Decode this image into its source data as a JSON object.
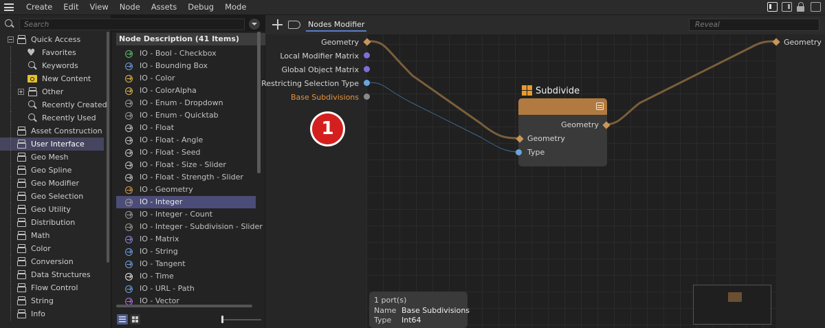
{
  "menubar": {
    "items": [
      "Create",
      "Edit",
      "View",
      "Node",
      "Assets",
      "Debug",
      "Mode"
    ]
  },
  "search": {
    "placeholder": "Search"
  },
  "tree": {
    "items": [
      {
        "label": "Quick Access",
        "icon": "database-icon"
      },
      {
        "label": "Favorites",
        "icon": "heart-icon"
      },
      {
        "label": "Keywords",
        "icon": "magnifier-icon"
      },
      {
        "label": "New Content",
        "icon": "folder-icon"
      },
      {
        "label": "Other",
        "icon": "database-icon"
      },
      {
        "label": "Recently Created",
        "icon": "magnifier-icon"
      },
      {
        "label": "Recently Used",
        "icon": "magnifier-icon"
      },
      {
        "label": "Asset Construction",
        "icon": "database-icon"
      },
      {
        "label": "User Interface",
        "icon": "database-icon"
      },
      {
        "label": "Geo Mesh",
        "icon": "database-icon"
      },
      {
        "label": "Geo Spline",
        "icon": "database-icon"
      },
      {
        "label": "Geo Modifier",
        "icon": "database-icon"
      },
      {
        "label": "Geo Selection",
        "icon": "database-icon"
      },
      {
        "label": "Geo Utility",
        "icon": "database-icon"
      },
      {
        "label": "Distribution",
        "icon": "database-icon"
      },
      {
        "label": "Math",
        "icon": "database-icon"
      },
      {
        "label": "Color",
        "icon": "database-icon"
      },
      {
        "label": "Conversion",
        "icon": "database-icon"
      },
      {
        "label": "Data Structures",
        "icon": "database-icon"
      },
      {
        "label": "Flow Control",
        "icon": "database-icon"
      },
      {
        "label": "String",
        "icon": "database-icon"
      },
      {
        "label": "Info",
        "icon": "database-icon"
      }
    ],
    "selected": "User Interface"
  },
  "node_description": {
    "header": "Node Description (41 Items)",
    "items": [
      {
        "label": "IO - Bool - Checkbox",
        "color": "#5fbf6a"
      },
      {
        "label": "IO - Bounding Box",
        "color": "#6fa0e0"
      },
      {
        "label": "IO - Color",
        "color": "#e0b84a"
      },
      {
        "label": "IO - ColorAlpha",
        "color": "#e0b84a"
      },
      {
        "label": "IO - Enum - Dropdown",
        "color": "#9a9a9a"
      },
      {
        "label": "IO - Enum - Quicktab",
        "color": "#9a9a9a"
      },
      {
        "label": "IO - Float",
        "color": "#c8c8c8"
      },
      {
        "label": "IO - Float - Angle",
        "color": "#c8c8c8"
      },
      {
        "label": "IO - Float - Seed",
        "color": "#c8c8c8"
      },
      {
        "label": "IO - Float - Size - Slider",
        "color": "#c8c8c8"
      },
      {
        "label": "IO - Float - Strength - Slider",
        "color": "#c8c8c8"
      },
      {
        "label": "IO - Geometry",
        "color": "#d69a4a"
      },
      {
        "label": "IO - Integer",
        "color": "#9a9a9a"
      },
      {
        "label": "IO - Integer - Count",
        "color": "#9a9a9a"
      },
      {
        "label": "IO - Integer - Subdivision - Slider",
        "color": "#9a9a9a"
      },
      {
        "label": "IO - Matrix",
        "color": "#8a86e0"
      },
      {
        "label": "IO - String",
        "color": "#6fa0e0"
      },
      {
        "label": "IO - Tangent",
        "color": "#6fa0e0"
      },
      {
        "label": "IO - Time",
        "color": "#e8e8e8"
      },
      {
        "label": "IO - URL - Path",
        "color": "#6fa0e0"
      },
      {
        "label": "IO - Vector",
        "color": "#b070e0"
      }
    ],
    "selected": "IO - Integer"
  },
  "editor": {
    "tab": "Nodes Modifier",
    "reveal_placeholder": "Reveal",
    "inputs": [
      {
        "label": "Geometry",
        "port": "diamond",
        "color": "#c8965a"
      },
      {
        "label": "Local Modifier Matrix",
        "port": "dot",
        "color": "#7a70d8"
      },
      {
        "label": "Global Object Matrix",
        "port": "dot",
        "color": "#7a70d8"
      },
      {
        "label": "Restricting Selection Type",
        "port": "dot",
        "color": "#6aa6dc"
      },
      {
        "label": "Base Subdivisions",
        "port": "dot",
        "color": "#8a8a8a"
      }
    ],
    "outputs": [
      {
        "label": "Geometry",
        "port": "diamond",
        "color": "#c8965a"
      }
    ],
    "node": {
      "title": "Subdivide",
      "header_color": "#b07a40",
      "outputs": [
        {
          "label": "Geometry"
        }
      ],
      "inputs": [
        {
          "label": "Geometry"
        },
        {
          "label": "Type"
        }
      ]
    },
    "badge": "1",
    "tooltip": {
      "count": "1 port(s)",
      "name_label": "Name",
      "name_value": "Base Subdivisions",
      "type_label": "Type",
      "type_value": "Int64"
    }
  }
}
